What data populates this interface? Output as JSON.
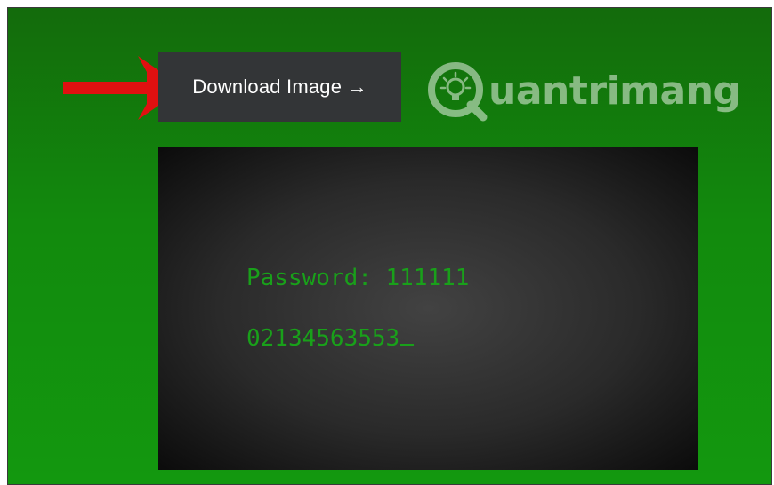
{
  "toolbar": {
    "download_label": "Download Image →"
  },
  "brand": {
    "name": "uantrimang"
  },
  "terminal": {
    "line1": "Password: 111111",
    "line2": "02134563553"
  },
  "colors": {
    "background_top": "#136b0c",
    "background_bottom": "#13980f",
    "button_bg": "#333537",
    "terminal_text": "#19a01a",
    "arrow": "#e01010"
  },
  "icons": {
    "annotation_arrow": "red-arrow-icon",
    "brand_logo": "lightbulb-q-logo-icon"
  }
}
